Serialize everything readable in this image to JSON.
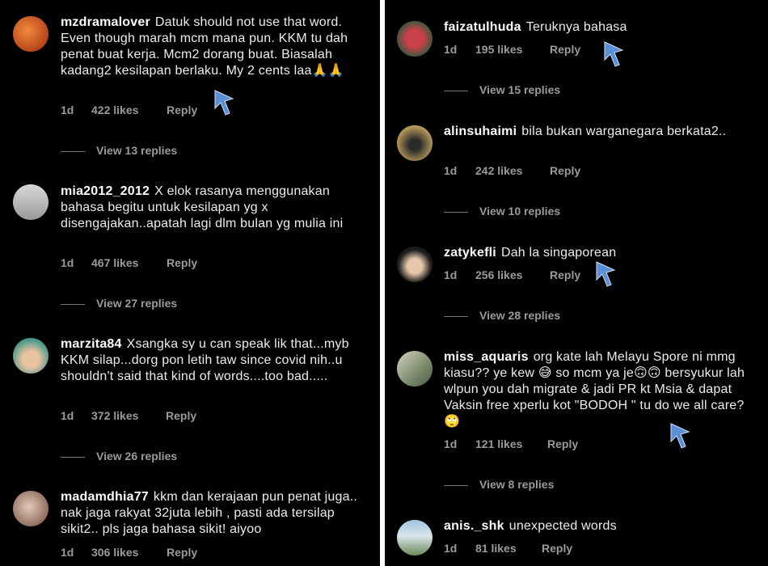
{
  "left_comments": [
    {
      "username": "mzdramalover",
      "text": "Datuk should not use that word. Even though marah mcm mana pun. KKM tu dah penat buat kerja. Mcm2 dorang buat. Biasalah kadang2 kesilapan berlaku. My 2 cents laa🙏🙏",
      "time": "1d",
      "likes": "422 likes",
      "reply": "Reply",
      "view_replies": "View 13 replies"
    },
    {
      "username": "mia2012_2012",
      "text": "X elok rasanya menggunakan bahasa begitu untuk kesilapan yg x disengajakan..apatah lagi dlm bulan yg mulia ini",
      "time": "1d",
      "likes": "467 likes",
      "reply": "Reply",
      "view_replies": "View 27 replies"
    },
    {
      "username": "marzita84",
      "text": "Xsangka sy u can speak lik that...myb KKM silap...dorg pon letih taw since covid nih..u shouldn't said that kind of words....too bad.....",
      "time": "1d",
      "likes": "372 likes",
      "reply": "Reply",
      "view_replies": "View 26 replies"
    },
    {
      "username": "madamdhia77",
      "text": "kkm dan kerajaan pun penat juga.. nak jaga rakyat 32juta lebih , pasti ada tersilap sikit2.. pls jaga bahasa sikit! aiyoo",
      "time": "1d",
      "likes": "306 likes",
      "reply": "Reply"
    }
  ],
  "right_comments": [
    {
      "username": "faizatulhuda",
      "text": "Teruknya bahasa",
      "time": "1d",
      "likes": "195 likes",
      "reply": "Reply",
      "view_replies": "View 15 replies"
    },
    {
      "username": "alinsuhaimi",
      "text": "bila bukan warganegara berkata2..",
      "time": "1d",
      "likes": "242 likes",
      "reply": "Reply",
      "view_replies": "View 10 replies"
    },
    {
      "username": "zatykefli",
      "text": "Dah la singaporean",
      "time": "1d",
      "likes": "256 likes",
      "reply": "Reply",
      "view_replies": "View 28 replies"
    },
    {
      "username": "miss_aquaris",
      "text": "org kate lah Melayu Spore ni mmg kiasu?? ye kew 😅 so mcm ya je🙃🙃 bersyukur lah wlpun you dah migrate & jadi PR kt Msia & dapat Vaksin free xperlu kot \"BODOH \" tu do we all care?🙄",
      "time": "1d",
      "likes": "121 likes",
      "reply": "Reply",
      "view_replies": "View 8 replies"
    },
    {
      "username": "anis._shk",
      "text": "unexpected words",
      "time": "1d",
      "likes": "81 likes",
      "reply": "Reply"
    }
  ],
  "colors": {
    "background": "#000000",
    "text": "#ececec",
    "muted": "#9a9a9a",
    "cursor": "#5b8fd6"
  }
}
